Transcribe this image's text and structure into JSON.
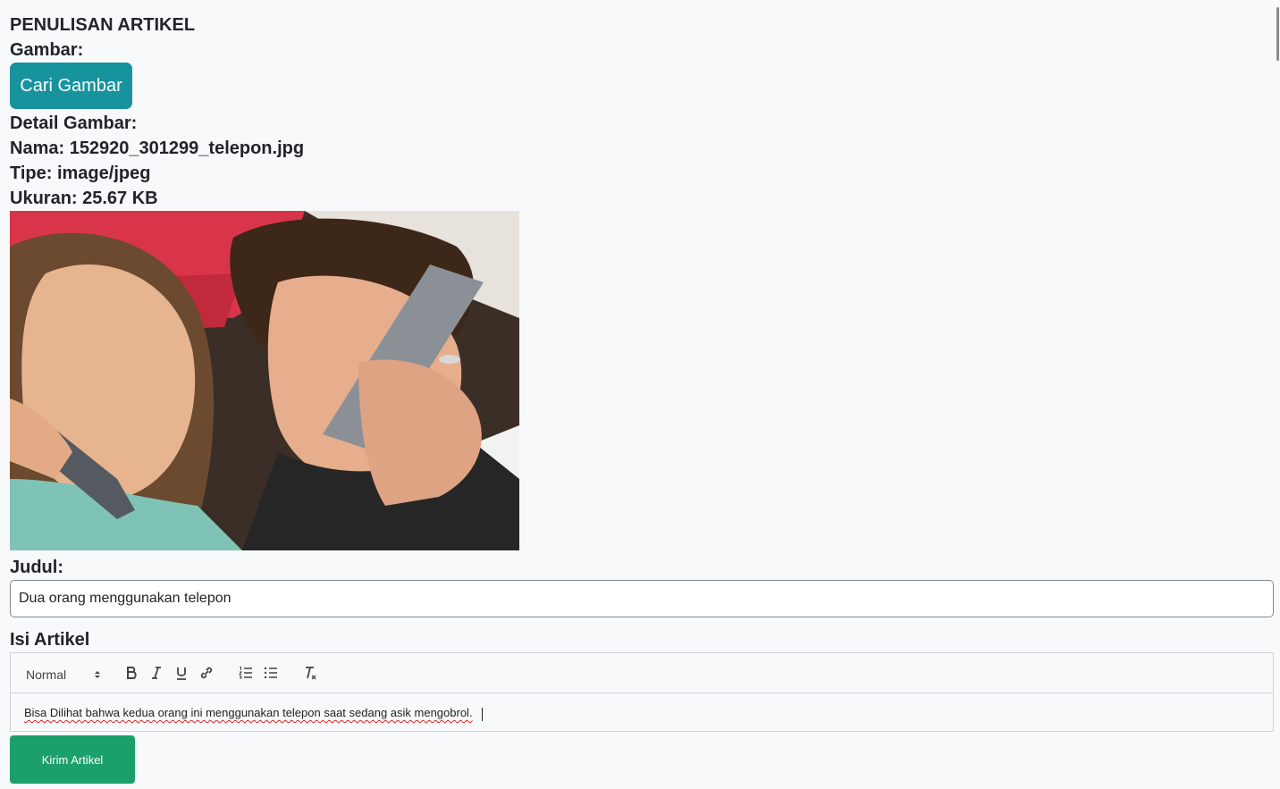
{
  "page": {
    "title": "PENULISAN ARTIKEL",
    "image_label": "Gambar:",
    "browse_button": "Cari Gambar",
    "detail_label": "Detail Gambar:",
    "file_name_line": "Nama: 152920_301299_telepon.jpg",
    "file_type_line": "Tipe: image/jpeg",
    "file_size_line": "Ukuran: 25.67 KB",
    "title_label": "Judul:",
    "title_value": "Dua orang menggunakan telepon",
    "content_label": "Isi Artikel",
    "submit_button": "Kirim Artikel"
  },
  "editor": {
    "format_select": "Normal",
    "toolbar_icons": [
      "bold-icon",
      "italic-icon",
      "underline-icon",
      "link-icon",
      "ordered-list-icon",
      "bullet-list-icon",
      "clear-format-icon"
    ],
    "content": "Bisa Dilihat bahwa kedua orang ini menggunakan telepon saat sedang asik mengobrol."
  },
  "colors": {
    "background": "#f8f9fa",
    "browse_button": "#17939e",
    "submit_button": "#1b9f6b",
    "spellcheck_underline": "#dd2222"
  }
}
